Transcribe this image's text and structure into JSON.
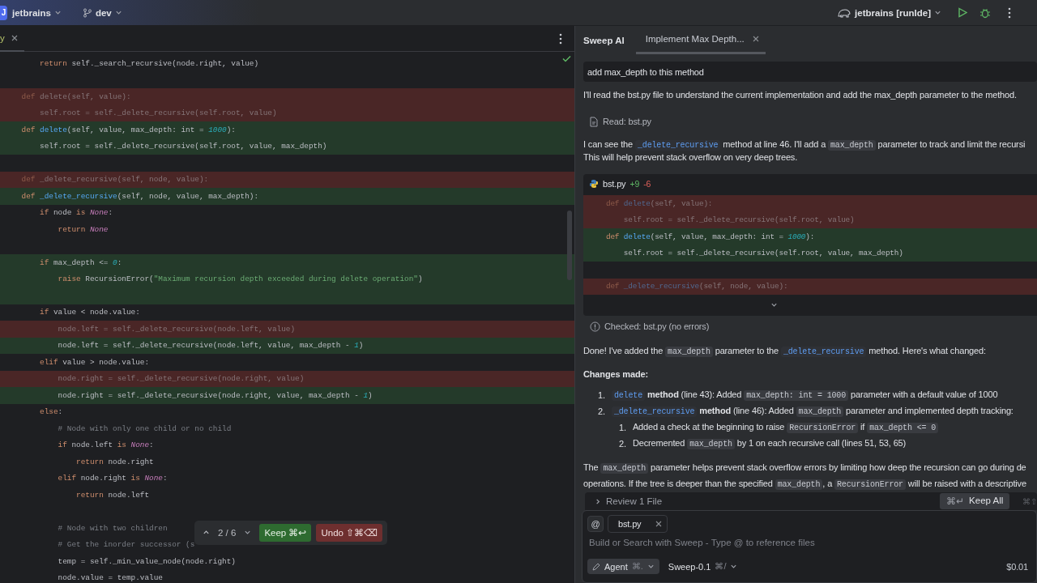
{
  "title_bar": {
    "project_badge": "J",
    "project": "jetbrains",
    "branch": "dev",
    "run_config": "jetbrains [runIde]"
  },
  "editor": {
    "tab": {
      "label": "y",
      "selected": true
    },
    "lines": [
      {
        "kind": "context",
        "segments": [
          {
            "text": "        return",
            "kind": "kw"
          },
          {
            "text": " self._search_recursive(node.right, value)",
            "kind": "plain"
          }
        ]
      },
      {
        "kind": "context"
      },
      {
        "kind": "removed",
        "segments": [
          {
            "text": "    def",
            "kind": "kw"
          },
          {
            "text": " delete(self, value):",
            "kind": "plain"
          }
        ]
      },
      {
        "kind": "removed",
        "segments": [
          {
            "text": "        self.root = self._delete_recursive(self.root, value)",
            "kind": "plain"
          }
        ]
      },
      {
        "kind": "added",
        "segments": [
          {
            "text": "    def ",
            "kind": "kw"
          },
          {
            "text": "delete",
            "kind": "fn"
          },
          {
            "text": "(self, value, max_depth: int = ",
            "kind": "plain"
          },
          {
            "text": "1000",
            "kind": "num"
          },
          {
            "text": "):",
            "kind": "plain"
          }
        ]
      },
      {
        "kind": "added",
        "segments": [
          {
            "text": "        self.root = self._delete_recursive(self.root, value, max_depth)",
            "kind": "plain"
          }
        ]
      },
      {
        "kind": "context"
      },
      {
        "kind": "removed",
        "segments": [
          {
            "text": "    def",
            "kind": "kw"
          },
          {
            "text": " _delete_recursive(self, node, value):",
            "kind": "plain"
          }
        ]
      },
      {
        "kind": "added",
        "segments": [
          {
            "text": "    def ",
            "kind": "kw"
          },
          {
            "text": "_delete_recursive",
            "kind": "fn"
          },
          {
            "text": "(self, node, value, max_depth):",
            "kind": "plain"
          }
        ]
      },
      {
        "kind": "context",
        "segments": [
          {
            "text": "        if",
            "kind": "kw"
          },
          {
            "text": " node ",
            "kind": "plain"
          },
          {
            "text": "is ",
            "kind": "kw"
          },
          {
            "text": "None",
            "kind": "const"
          },
          {
            "text": ":",
            "kind": "plain"
          }
        ]
      },
      {
        "kind": "context",
        "segments": [
          {
            "text": "            return ",
            "kind": "kw"
          },
          {
            "text": "None",
            "kind": "const"
          }
        ]
      },
      {
        "kind": "context"
      },
      {
        "kind": "added",
        "segments": [
          {
            "text": "        if",
            "kind": "kw"
          },
          {
            "text": " max_depth <= ",
            "kind": "plain"
          },
          {
            "text": "0",
            "kind": "num"
          },
          {
            "text": ":",
            "kind": "plain"
          }
        ]
      },
      {
        "kind": "added",
        "segments": [
          {
            "text": "            raise",
            "kind": "kw"
          },
          {
            "text": " RecursionError(",
            "kind": "plain"
          },
          {
            "text": "\"Maximum recursion depth exceeded during delete operation\"",
            "kind": "str"
          },
          {
            "text": ")",
            "kind": "plain"
          }
        ]
      },
      {
        "kind": "added"
      },
      {
        "kind": "context",
        "segments": [
          {
            "text": "        if",
            "kind": "kw"
          },
          {
            "text": " value < node.value:",
            "kind": "plain"
          }
        ]
      },
      {
        "kind": "removed",
        "segments": [
          {
            "text": "            node.left = self._delete_recursive(node.left, value)",
            "kind": "plain"
          }
        ]
      },
      {
        "kind": "added",
        "segments": [
          {
            "text": "            node.left = self._delete_recursive(node.left, value, max_depth - ",
            "kind": "plain"
          },
          {
            "text": "1",
            "kind": "num"
          },
          {
            "text": ")",
            "kind": "plain"
          }
        ]
      },
      {
        "kind": "context",
        "segments": [
          {
            "text": "        elif",
            "kind": "kw"
          },
          {
            "text": " value > node.value:",
            "kind": "plain"
          }
        ]
      },
      {
        "kind": "removed",
        "segments": [
          {
            "text": "            node.right = self._delete_recursive(node.right, value)",
            "kind": "plain"
          }
        ]
      },
      {
        "kind": "added",
        "segments": [
          {
            "text": "            node.right = self._delete_recursive(node.right, value, max_depth - ",
            "kind": "plain"
          },
          {
            "text": "1",
            "kind": "num"
          },
          {
            "text": ")",
            "kind": "plain"
          }
        ]
      },
      {
        "kind": "context",
        "segments": [
          {
            "text": "        else",
            "kind": "kw"
          },
          {
            "text": ":",
            "kind": "plain"
          }
        ]
      },
      {
        "kind": "context",
        "segments": [
          {
            "text": "            # Node with only one child or no child",
            "kind": "cmt"
          }
        ]
      },
      {
        "kind": "context",
        "segments": [
          {
            "text": "            if",
            "kind": "kw"
          },
          {
            "text": " node.left ",
            "kind": "plain"
          },
          {
            "text": "is ",
            "kind": "kw"
          },
          {
            "text": "None",
            "kind": "const"
          },
          {
            "text": ":",
            "kind": "plain"
          }
        ]
      },
      {
        "kind": "context",
        "segments": [
          {
            "text": "                return",
            "kind": "kw"
          },
          {
            "text": " node.right",
            "kind": "plain"
          }
        ]
      },
      {
        "kind": "context",
        "segments": [
          {
            "text": "            elif",
            "kind": "kw"
          },
          {
            "text": " node.right ",
            "kind": "plain"
          },
          {
            "text": "is ",
            "kind": "kw"
          },
          {
            "text": "None",
            "kind": "const"
          },
          {
            "text": ":",
            "kind": "plain"
          }
        ]
      },
      {
        "kind": "context",
        "segments": [
          {
            "text": "                return",
            "kind": "kw"
          },
          {
            "text": " node.left",
            "kind": "plain"
          }
        ]
      },
      {
        "kind": "context"
      },
      {
        "kind": "context",
        "segments": [
          {
            "text": "            # Node with two children",
            "kind": "cmt"
          }
        ]
      },
      {
        "kind": "context",
        "segments": [
          {
            "text": "            # Get the inorder successor (s",
            "kind": "cmt"
          }
        ]
      },
      {
        "kind": "context",
        "segments": [
          {
            "text": "            temp = self._min_value_node(node.right)",
            "kind": "plain"
          }
        ]
      },
      {
        "kind": "context",
        "segments": [
          {
            "text": "            node.value = temp.value",
            "kind": "plain"
          }
        ]
      }
    ],
    "change_popup": {
      "counter": "2 / 6",
      "keep": "Keep ⌘↩",
      "undo": "Undo ⇧⌘⌫"
    }
  },
  "chat": {
    "title": "Sweep AI",
    "tabs": [
      {
        "label": "Implement Max Depth...",
        "selected": true
      }
    ],
    "user_message": "add max_depth to this method",
    "intro": "I'll read the bst.py file to understand the current implementation and add the max_depth parameter to the method.",
    "tool_read": "Read: bst.py",
    "plan": [
      [
        {
          "text": "I can see the ",
          "kind": "text"
        },
        {
          "text": "_delete_recursive",
          "kind": "symbol"
        },
        {
          "text": " method at line 46. I'll add a ",
          "kind": "text"
        },
        {
          "text": "max_depth",
          "kind": "code"
        },
        {
          "text": " parameter to track and limit the recursi",
          "kind": "text"
        }
      ],
      [
        {
          "text": "This will help prevent stack overflow on very deep trees.",
          "kind": "text"
        }
      ]
    ],
    "diff": {
      "file": "bst.py",
      "additions": "+9",
      "deletions": "-6",
      "lines": [
        {
          "kind": "removed",
          "segments": [
            {
              "text": "    def ",
              "kind": "kw"
            },
            {
              "text": "delete",
              "kind": "fn"
            },
            {
              "text": "(self, value):",
              "kind": "plain"
            }
          ]
        },
        {
          "kind": "removed",
          "segments": [
            {
              "text": "        self.root = self._delete_recursive(self.root, value)",
              "kind": "plain"
            }
          ]
        },
        {
          "kind": "added",
          "segments": [
            {
              "text": "    def ",
              "kind": "kw"
            },
            {
              "text": "delete",
              "kind": "fn"
            },
            {
              "text": "(self, value, max_depth: int = ",
              "kind": "plain"
            },
            {
              "text": "1000",
              "kind": "num"
            },
            {
              "text": "):",
              "kind": "plain"
            }
          ]
        },
        {
          "kind": "added",
          "segments": [
            {
              "text": "        self.root = self._delete_recursive(self.root, value, max_depth)",
              "kind": "plain"
            }
          ]
        },
        {
          "kind": "context"
        },
        {
          "kind": "removed",
          "segments": [
            {
              "text": "    def ",
              "kind": "kw"
            },
            {
              "text": "_delete_recursive",
              "kind": "fn"
            },
            {
              "text": "(self, node, value):",
              "kind": "plain"
            }
          ]
        }
      ]
    },
    "check_result": "Checked: bst.py (no errors)",
    "summary": [
      {
        "text": "Done! I've added the ",
        "kind": "text"
      },
      {
        "text": "max_depth",
        "kind": "code"
      },
      {
        "text": " parameter to the ",
        "kind": "text"
      },
      {
        "text": "_delete_recursive",
        "kind": "symbol"
      },
      {
        "text": " method. Here's what changed:",
        "kind": "text"
      }
    ],
    "changes_heading": "Changes made:",
    "changes": [
      {
        "number": "1.",
        "segments": [
          {
            "text": "delete",
            "kind": "symbol"
          },
          {
            "text": " method",
            "kind": "bold"
          },
          {
            "text": " (line 43): Added ",
            "kind": "text"
          },
          {
            "text": "max_depth: int = 1000",
            "kind": "code"
          },
          {
            "text": " parameter with a default value of 1000",
            "kind": "text"
          }
        ]
      },
      {
        "number": "2.",
        "segments": [
          {
            "text": "_delete_recursive",
            "kind": "symbol"
          },
          {
            "text": " method",
            "kind": "bold"
          },
          {
            "text": " (line 46): Added ",
            "kind": "text"
          },
          {
            "text": "max_depth",
            "kind": "code"
          },
          {
            "text": " parameter and implemented depth tracking:",
            "kind": "text"
          }
        ],
        "children": [
          {
            "number": "1.",
            "segments": [
              {
                "text": "Added a check at the beginning to raise ",
                "kind": "text"
              },
              {
                "text": "RecursionError",
                "kind": "code"
              },
              {
                "text": " if ",
                "kind": "text"
              },
              {
                "text": "max_depth <= 0",
                "kind": "code"
              }
            ]
          },
          {
            "number": "2.",
            "segments": [
              {
                "text": "Decremented ",
                "kind": "text"
              },
              {
                "text": "max_depth",
                "kind": "code"
              },
              {
                "text": " by 1 on each recursive call (lines 51, 53, 65)",
                "kind": "text"
              }
            ]
          }
        ]
      }
    ],
    "closing": [
      [
        {
          "text": "The ",
          "kind": "text"
        },
        {
          "text": "max_depth",
          "kind": "code"
        },
        {
          "text": " parameter helps prevent stack overflow errors by limiting how deep the recursion can go during de",
          "kind": "text"
        }
      ],
      [
        {
          "text": "operations. If the tree is deeper than the specified ",
          "kind": "text"
        },
        {
          "text": "max_depth",
          "kind": "code"
        },
        {
          "text": ", a ",
          "kind": "text"
        },
        {
          "text": "RecursionError",
          "kind": "code"
        },
        {
          "text": " will be raised with a descriptive",
          "kind": "text"
        }
      ]
    ],
    "review": {
      "label": "Review 1 File",
      "keep_all_shortcut": "⌘↵",
      "keep_all": "Keep All",
      "reject_shortcut": "⌘⇧"
    },
    "composer": {
      "mention": "@",
      "attachment": "bst.py",
      "placeholder": "Build or Search with Sweep - Type @ to reference files",
      "mode": "Agent",
      "mode_shortcut": "⌘.",
      "model": "Sweep-0.1",
      "model_shortcut": "⌘/",
      "cost": "$0.01"
    }
  }
}
